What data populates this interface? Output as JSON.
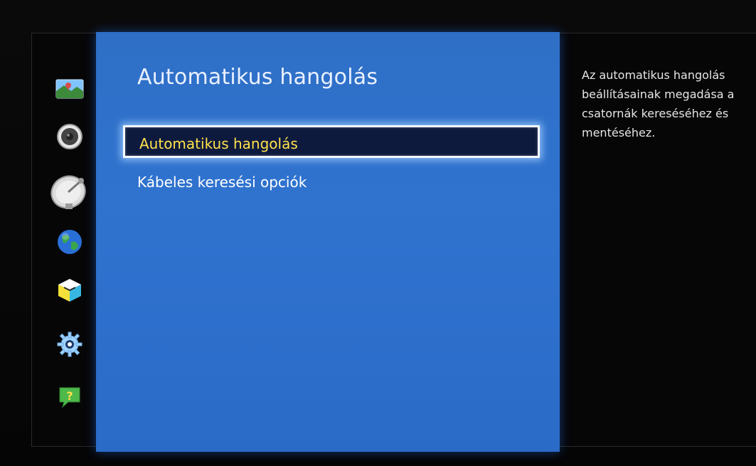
{
  "panel": {
    "title": "Automatikus hangolás"
  },
  "menu": {
    "items": [
      {
        "label": "Automatikus hangolás",
        "selected": true
      },
      {
        "label": "Kábeles keresési opciók",
        "selected": false
      }
    ]
  },
  "help": {
    "text": "Az automatikus hangolás\nbeállításainak megadása a\ncsatornák kereséséhez és\nmentéséhez."
  },
  "sidebar": {
    "icons": [
      "picture-icon",
      "sound-icon",
      "broadcast-satellite-icon",
      "network-globe-icon",
      "smart-features-cube-icon",
      "settings-gear-icon",
      "support-question-icon"
    ]
  },
  "colors": {
    "panel_blue": "#2f6fc6",
    "selected_bg": "#0e1a3d",
    "selected_text": "#ffe14d",
    "text": "#ffffff"
  }
}
